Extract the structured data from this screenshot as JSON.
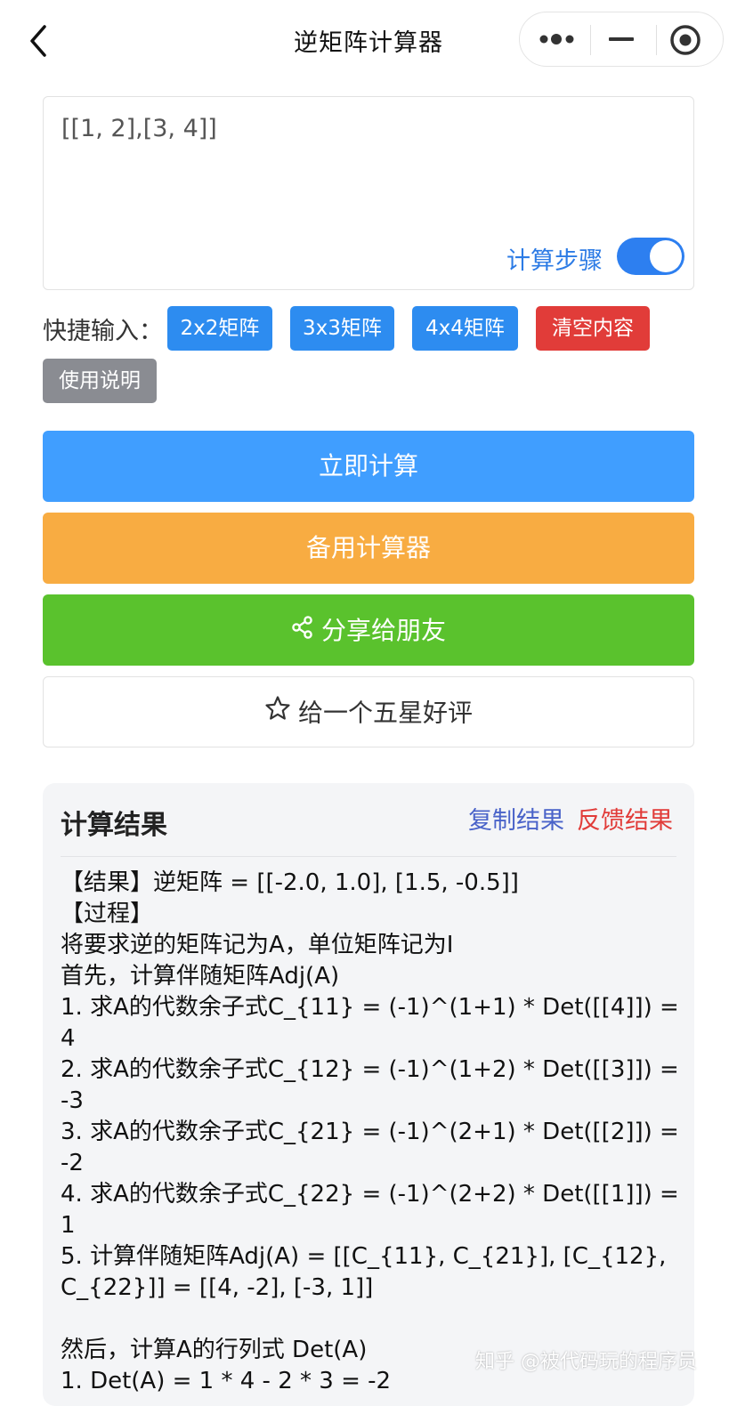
{
  "nav": {
    "title": "逆矩阵计算器",
    "back_icon": "chevron-left-icon",
    "more_icon": "more-dots-icon",
    "minimize_icon": "minimize-icon",
    "close_icon": "target-close-icon"
  },
  "input": {
    "value": "[[1, 2],[3, 4]]",
    "steps_label": "计算步骤",
    "steps_toggle_on": true
  },
  "quick": {
    "label": "快捷输入：",
    "buttons": [
      "2x2矩阵",
      "3x3矩阵",
      "4x4矩阵",
      "清空内容",
      "使用说明"
    ]
  },
  "actions": {
    "calculate": "立即计算",
    "backup": "备用计算器",
    "share": "分享给朋友",
    "share_icon": "share-icon",
    "rate": "给一个五星好评",
    "rate_icon": "star-icon"
  },
  "result": {
    "title": "计算结果",
    "copy": "复制结果",
    "feedback": "反馈结果",
    "lines": [
      "【结果】逆矩阵 = [[-2.0, 1.0], [1.5, -0.5]]",
      "【过程】",
      "将要求逆的矩阵记为A，单位矩阵记为I",
      "首先，计算伴随矩阵Adj(A)",
      "1. 求A的代数余子式C_{11} = (-1)^(1+1) * Det([[4]]) = 4",
      "2. 求A的代数余子式C_{12} = (-1)^(1+2) * Det([[3]]) = -3",
      "3. 求A的代数余子式C_{21} = (-1)^(2+1) * Det([[2]]) = -2",
      "4. 求A的代数余子式C_{22} = (-1)^(2+2) * Det([[1]]) = 1",
      "5. 计算伴随矩阵Adj(A) = [[C_{11}, C_{21}], [C_{12}, C_{22}]] = [[4, -2], [-3, 1]]",
      "",
      "然后，计算A的行列式 Det(A)",
      "1. Det(A) = 1 * 4 - 2 * 3 = -2"
    ]
  },
  "watermark": "知乎 @被代码玩的程序员",
  "colors": {
    "blue_button": "#2d8cf0",
    "calc_button": "#409eff",
    "backup_button": "#f8ac42",
    "share_button": "#5ac22d",
    "clear_button": "#e13c39",
    "help_button": "#8a8c92"
  }
}
